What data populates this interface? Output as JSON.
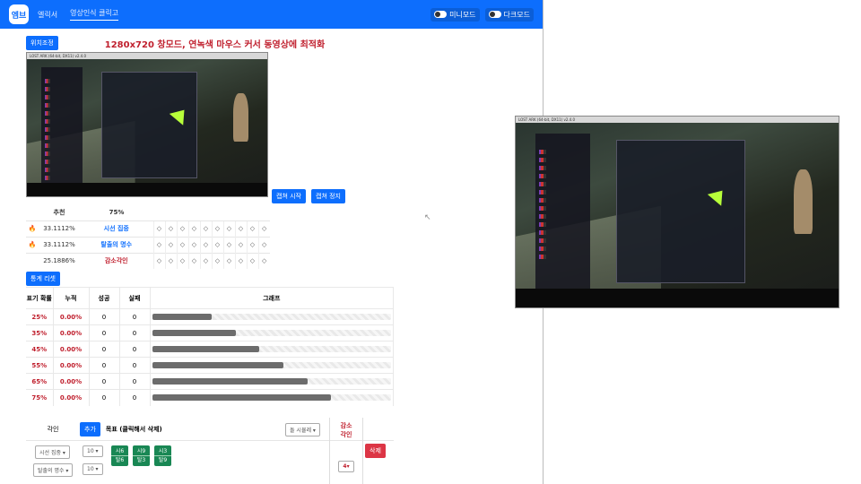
{
  "nav": {
    "logo": "엠브",
    "links": [
      "엘릭서",
      "영상인식 클릭고"
    ],
    "toggle_mini": "미니모드",
    "toggle_dark": "다크모드"
  },
  "top": {
    "position_button": "위치조정",
    "headline": "1280x720 창모드, 연녹색 마우스 커서 동영상에 최적화"
  },
  "preview": {
    "titlebar": "LOST ARK (64-bit, DX11) v2.4.0"
  },
  "actions": {
    "start": "캡쳐 시작",
    "stop": "캡쳐 정지"
  },
  "recommend": {
    "header_label": "추천",
    "header_pct": "75%",
    "rows": [
      {
        "icon": "🔥",
        "pct": "33.1112%",
        "name": "시선 집중",
        "style": "blue"
      },
      {
        "icon": "🔥",
        "pct": "33.1112%",
        "name": "탈출의 명수",
        "style": "blue"
      },
      {
        "icon": "",
        "pct": "25.1886%",
        "name": "감소각인",
        "style": "red"
      }
    ],
    "diamond": "◇"
  },
  "stats": {
    "reset_button": "통계 리셋",
    "headers": {
      "prob": "표기 확률",
      "cumulative": "누적",
      "success": "성공",
      "fail": "실패",
      "graph": "그래프"
    },
    "rows": [
      {
        "prob": "25%",
        "cumulative": "0.00%",
        "success": "0",
        "fail": "0",
        "fill": 0.25
      },
      {
        "prob": "35%",
        "cumulative": "0.00%",
        "success": "0",
        "fail": "0",
        "fill": 0.35
      },
      {
        "prob": "45%",
        "cumulative": "0.00%",
        "success": "0",
        "fail": "0",
        "fill": 0.45
      },
      {
        "prob": "55%",
        "cumulative": "0.00%",
        "success": "0",
        "fail": "0",
        "fill": 0.55
      },
      {
        "prob": "65%",
        "cumulative": "0.00%",
        "success": "0",
        "fail": "0",
        "fill": 0.65
      },
      {
        "prob": "75%",
        "cumulative": "0.00%",
        "success": "0",
        "fail": "0",
        "fill": 0.75
      }
    ]
  },
  "engrave": {
    "label": "각인",
    "add_button": "추가",
    "goal_label": "목표 (클릭해서 삭제)",
    "preset_dropdown": "돌 시뮬레",
    "decrease_label": "감소\n각인",
    "delete_button": "삭제",
    "rows": [
      {
        "name": "시선 집중",
        "value": "10"
      },
      {
        "name": "탈출의 명수",
        "value": "10"
      }
    ],
    "goals": [
      {
        "top": "시6",
        "bottom": "탈6"
      },
      {
        "top": "시9",
        "bottom": "탈3"
      },
      {
        "top": "시3",
        "bottom": "탈9"
      }
    ],
    "decrease_value": "4"
  },
  "popup": {
    "titlebar": "LOST ARK (64-bit, DX11) v2.4.0"
  }
}
